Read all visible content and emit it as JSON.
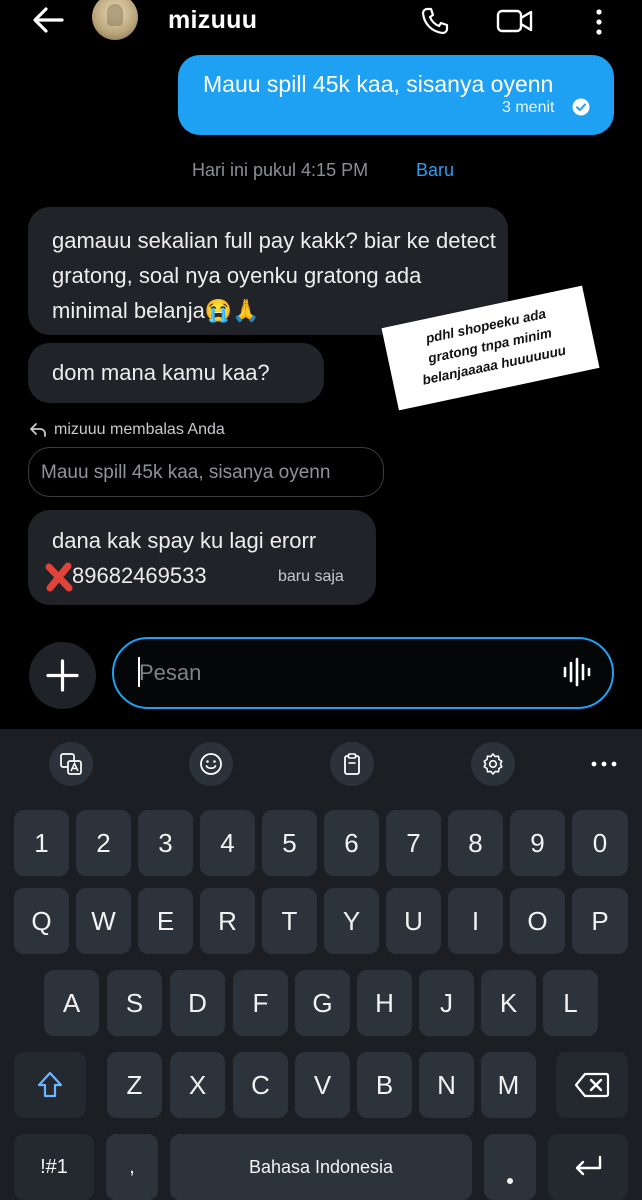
{
  "header": {
    "contact_name": "mizuuu",
    "icons": [
      "back-icon",
      "avatar",
      "call-icon",
      "video-call-icon",
      "more-vert-icon"
    ]
  },
  "messages": {
    "outgoing": {
      "text": "Mauu spill 45k kaa, sisanya oyenn",
      "time": "3 menit"
    },
    "date_divider": {
      "text": "Hari ini pukul 4:15 PM",
      "badge": "Baru"
    },
    "incoming_1": {
      "text": "gamauu sekalian full pay kakk? biar ke detect gratong, soal nya oyenku gratong ada minimal belanja😭🙏"
    },
    "incoming_2": {
      "text": "dom mana kamu kaa?"
    },
    "reply_header": "mizuuu membalas Anda",
    "quoted_text": "Mauu spill 45k kaa, sisanya oyenn",
    "incoming_3": {
      "line1": "dana kak spay ku lagi erorr",
      "phone": "89682469533",
      "time": "baru saja"
    }
  },
  "sticker": {
    "text_lines": [
      "pdhl shopeeku ada",
      "gratong tnpa minim",
      "belanjaaaaa huuuuuuu"
    ]
  },
  "composer": {
    "placeholder": "Pesan"
  },
  "keyboard": {
    "toolbar_icons": [
      "translate-icon",
      "emoji-icon",
      "clipboard-icon",
      "settings-icon",
      "more-horiz-icon"
    ],
    "number_row": [
      "1",
      "2",
      "3",
      "4",
      "5",
      "6",
      "7",
      "8",
      "9",
      "0"
    ],
    "row1": [
      "Q",
      "W",
      "E",
      "R",
      "T",
      "Y",
      "U",
      "I",
      "O",
      "P"
    ],
    "row2": [
      "A",
      "S",
      "D",
      "F",
      "G",
      "H",
      "J",
      "K",
      "L"
    ],
    "row3": [
      "Z",
      "X",
      "C",
      "V",
      "B",
      "N",
      "M"
    ],
    "symbols_key": "!#1",
    "comma_key": ",",
    "space_label": "Bahasa Indonesia",
    "colors": {
      "key": "#2d333b",
      "background": "#1b1f24",
      "accent": "#1ea1f2"
    }
  }
}
